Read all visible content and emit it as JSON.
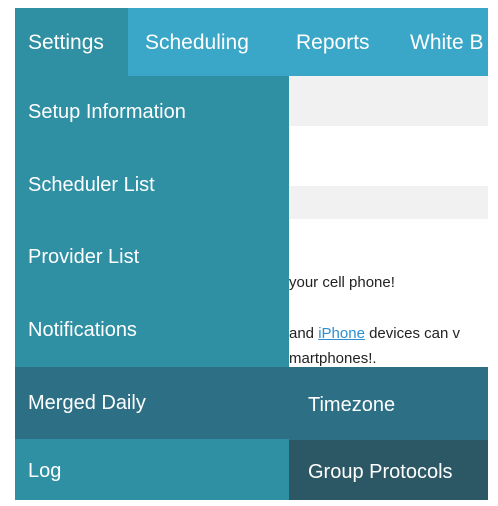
{
  "topnav": {
    "tabs": [
      {
        "label": "Settings"
      },
      {
        "label": "Scheduling"
      },
      {
        "label": "Reports"
      },
      {
        "label": "White B"
      }
    ]
  },
  "dropdown": {
    "items": [
      {
        "label": "Setup Information"
      },
      {
        "label": "Scheduler List"
      },
      {
        "label": "Provider List"
      },
      {
        "label": "Notifications"
      },
      {
        "label": "Merged Daily"
      },
      {
        "label": "Log"
      }
    ]
  },
  "submenu": {
    "items": [
      {
        "label": "Timezone"
      },
      {
        "label": "Group Protocols"
      }
    ]
  },
  "content": {
    "line1": "your cell phone!",
    "line2_prefix": "and ",
    "line2_link": "iPhone",
    "line2_suffix": " devices can v",
    "line3": "martphones!."
  }
}
